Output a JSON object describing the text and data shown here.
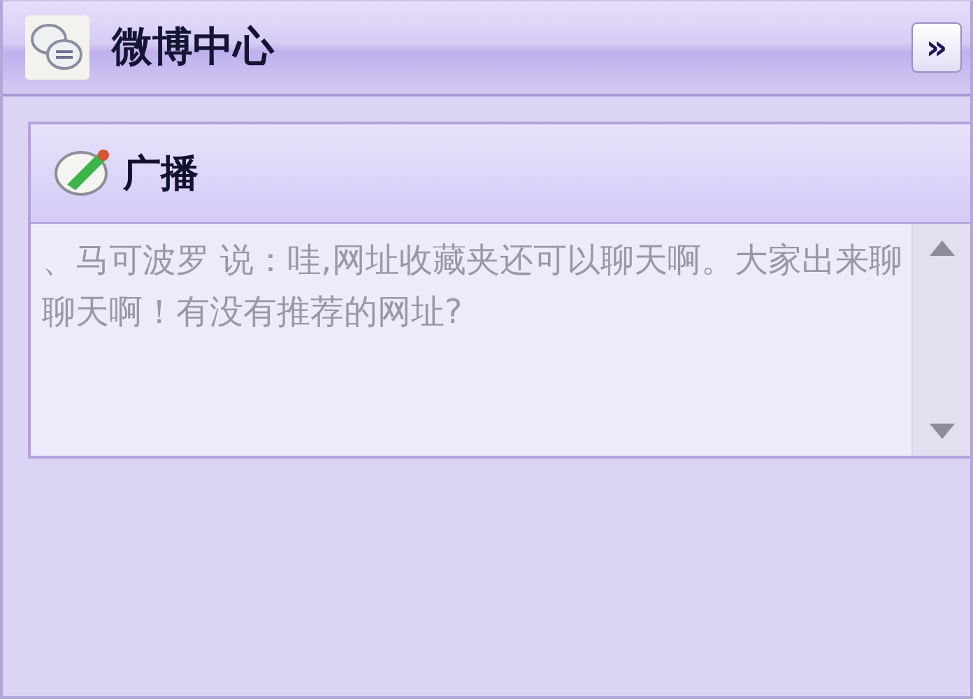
{
  "window": {
    "title": "微博中心",
    "collapse_button": "»"
  },
  "section": {
    "title": "广播",
    "message": "、马可波罗 说：哇,网址收藏夹还可以聊天啊。大家出来聊聊天啊！有没有推荐的网址?"
  }
}
